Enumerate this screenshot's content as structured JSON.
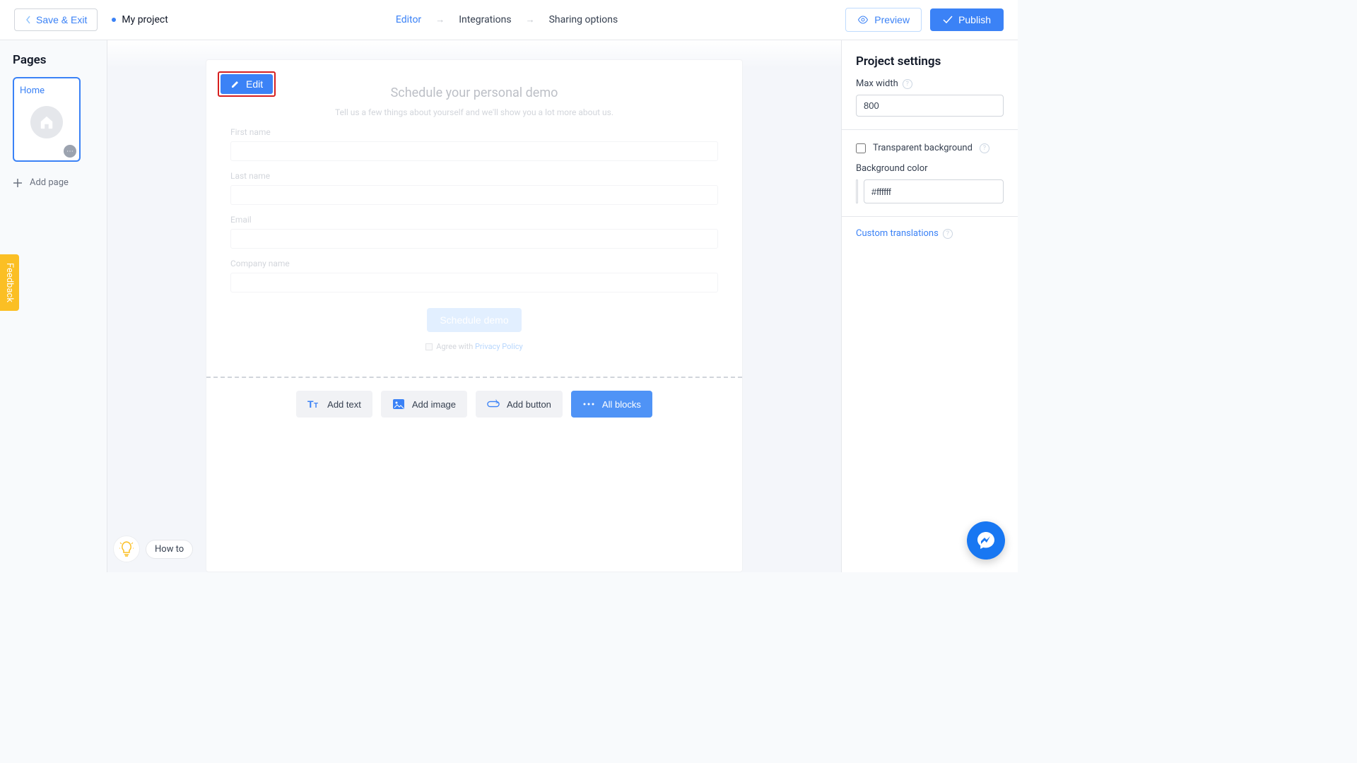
{
  "topbar": {
    "save_exit": "Save & Exit",
    "project_name": "My project",
    "stages": {
      "editor": "Editor",
      "integrations": "Integrations",
      "sharing": "Sharing options"
    },
    "preview": "Preview",
    "publish": "Publish"
  },
  "left": {
    "heading": "Pages",
    "page_label": "Home",
    "add_page": "Add page"
  },
  "canvas": {
    "edit_label": "Edit",
    "form_title": "Schedule your personal demo",
    "form_sub": "Tell us a few things about yourself and we'll show you a lot more about us.",
    "fields": {
      "first": "First name",
      "last": "Last name",
      "email": "Email",
      "company": "Company name"
    },
    "submit": "Schedule demo",
    "privacy_pre": "Agree with ",
    "privacy_link": "Privacy Policy",
    "tools": {
      "text": "Add text",
      "image": "Add image",
      "button": "Add button",
      "all": "All blocks"
    }
  },
  "right": {
    "heading": "Project settings",
    "max_width_label": "Max width",
    "max_width_value": "800",
    "transparent_label": "Transparent background",
    "bg_label": "Background color",
    "bg_value": "#ffffff",
    "custom_link": "Custom translations"
  },
  "feedback": "Feedback",
  "howto": "How to"
}
